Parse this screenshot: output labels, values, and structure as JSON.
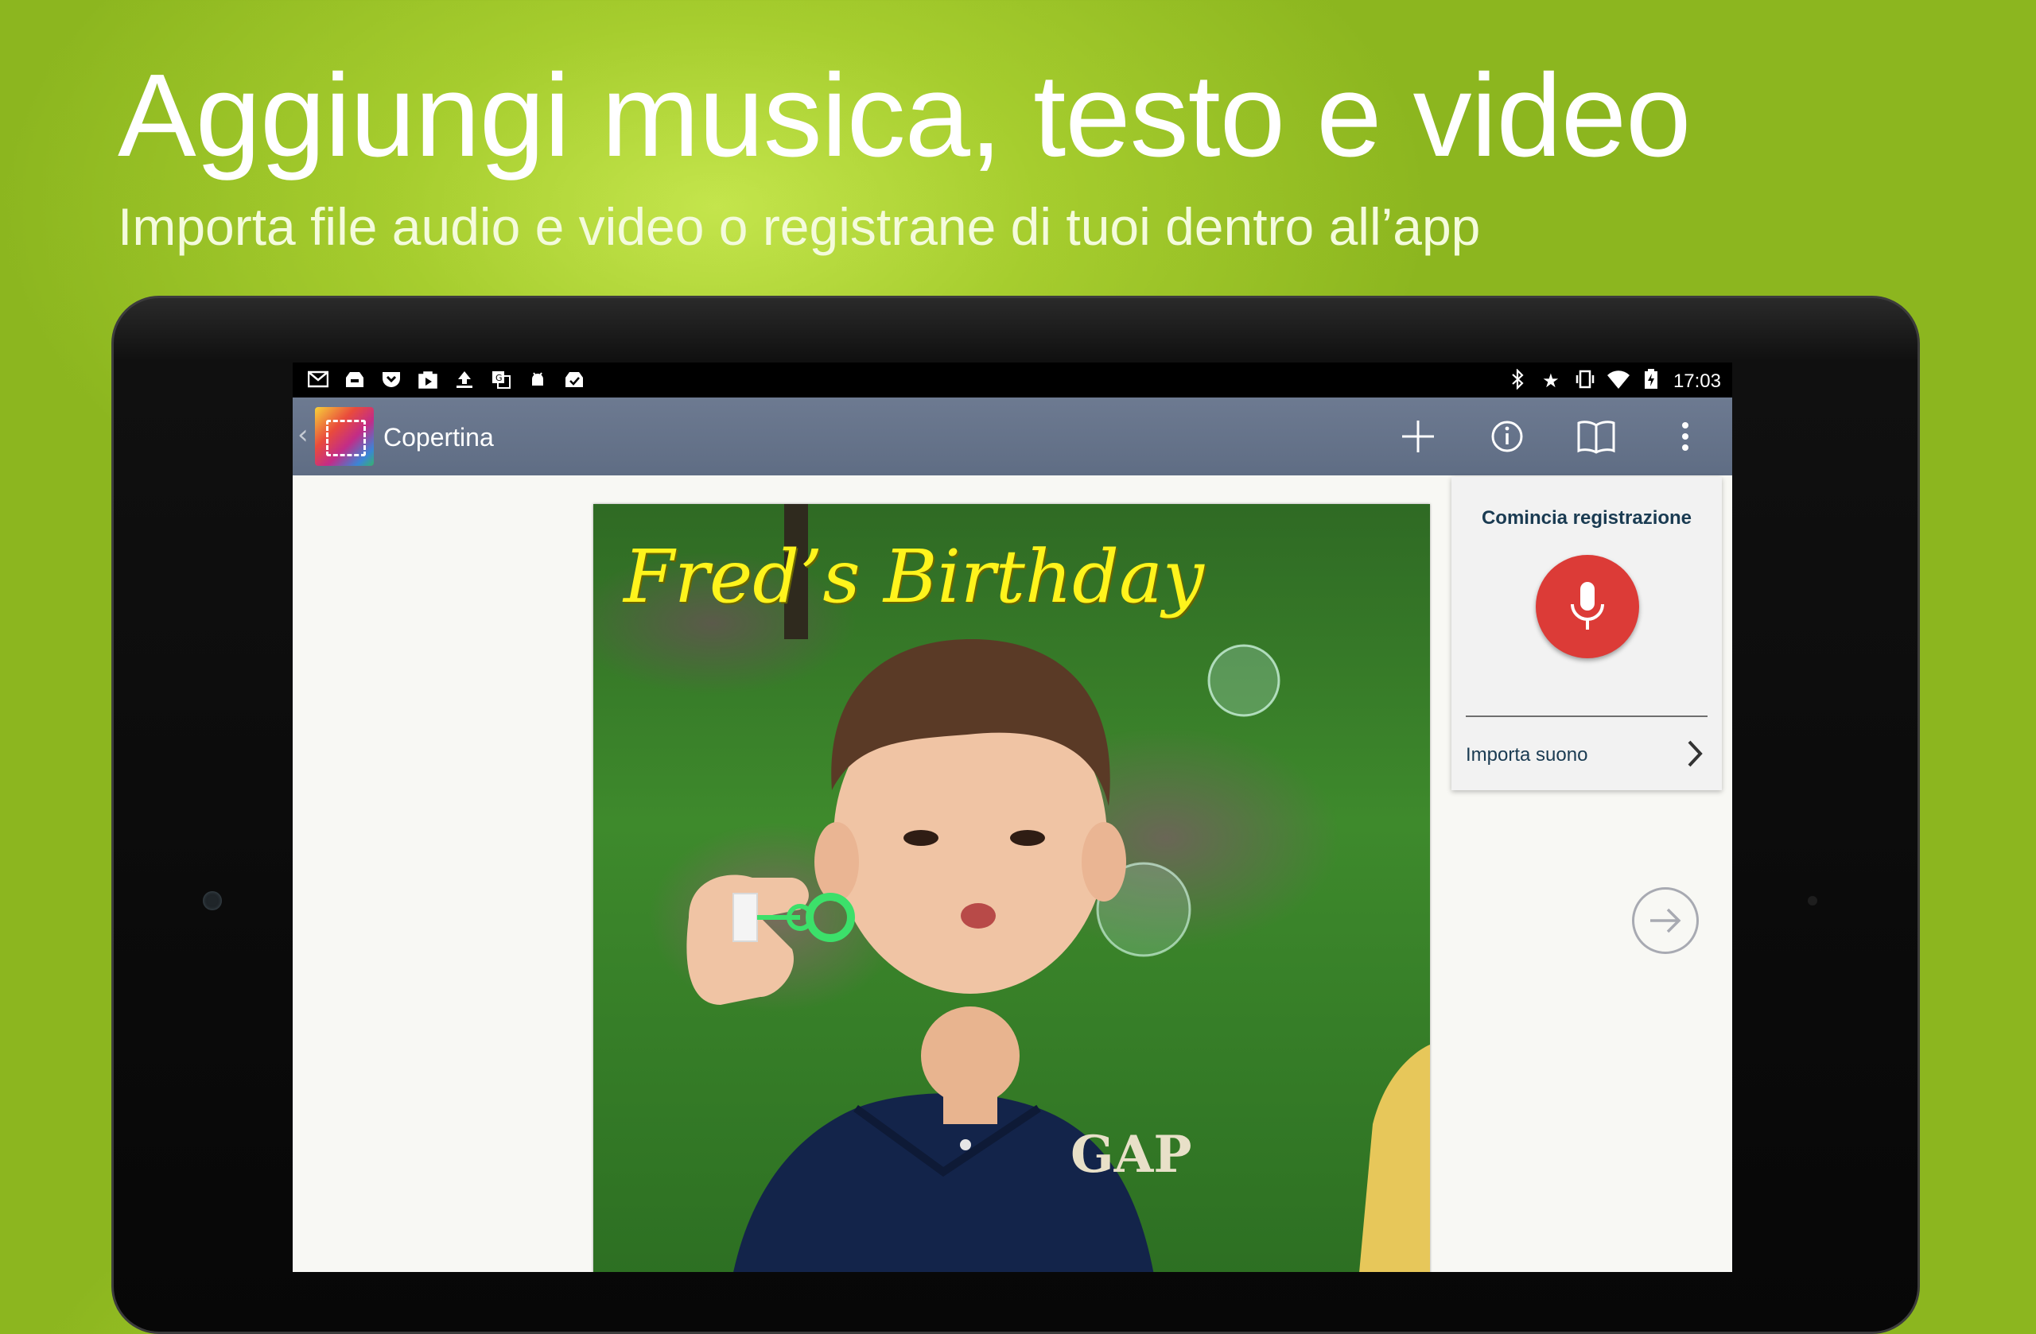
{
  "promo": {
    "headline": "Aggiungi musica, testo e video",
    "subheadline": "Importa file audio e video o registrane di tuoi dentro all’app"
  },
  "statusbar": {
    "notification_icons": [
      "gmail-icon",
      "inbox-icon",
      "pocket-icon",
      "play-store-icon",
      "upload-icon",
      "translate-icon",
      "android-icon",
      "task-icon"
    ],
    "system_icons": [
      "bluetooth-icon",
      "star-icon",
      "vibrate-icon",
      "wifi-icon",
      "battery-icon"
    ],
    "time": "17:03"
  },
  "actionbar": {
    "title": "Copertina",
    "actions": [
      "add-icon",
      "info-icon",
      "book-icon",
      "overflow-icon"
    ]
  },
  "page": {
    "photo_title": "Fred’s Birthday"
  },
  "record_panel": {
    "title": "Comincia registrazione",
    "import_label": "Importa suono"
  },
  "colors": {
    "background": "#a6cd2e",
    "actionbar": "#64728a",
    "record_button": "#dc3b37",
    "photo_title": "#fff41c",
    "panel_text": "#1a3b52"
  }
}
